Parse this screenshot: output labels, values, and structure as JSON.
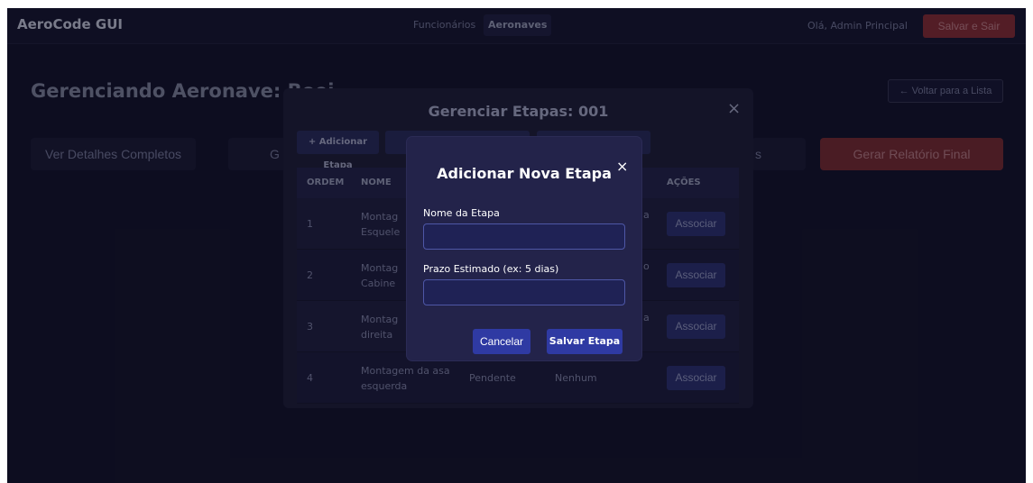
{
  "header": {
    "logo": "AeroCode GUI",
    "nav": [
      "Funcionários",
      "Aeronaves"
    ],
    "active_nav": "Aeronaves",
    "greeting": "Olá, Admin Principal",
    "save_exit_label": "Salvar e Sair"
  },
  "page": {
    "title_visible": "Gerenciando Aeronave: Boei",
    "back_label": "← Voltar para a Lista",
    "actions": [
      "Ver Detalhes Completos",
      "G",
      "s",
      "Gerar Relatório Final"
    ]
  },
  "etapas_modal": {
    "title": "Gerenciar Etapas: 001",
    "close_glyph": "×",
    "add_etapa_label": "+ Adicionar Etapa",
    "table": {
      "headers": {
        "ordem": "ORDEM",
        "nome": "NOME",
        "acoes": "AÇÕES"
      },
      "rows": [
        {
          "ordem": "1",
          "nome_line1": "Montag",
          "nome_line2": "Esquele",
          "status": "",
          "func": "a"
        },
        {
          "ordem": "2",
          "nome_line1": "Montag",
          "nome_line2": "Cabine",
          "status": "",
          "func": "o"
        },
        {
          "ordem": "3",
          "nome_line1": "Montag",
          "nome_line2": "direita",
          "status": "",
          "func": "a"
        },
        {
          "ordem": "4",
          "nome_line1": "Montagem da asa",
          "nome_line2": "esquerda",
          "status": "Pendente",
          "func": "Nenhum"
        }
      ],
      "assoc_label": "Associar"
    }
  },
  "add_modal": {
    "title": "Adicionar Nova Etapa",
    "close_glyph": "×",
    "name_label": "Nome da Etapa",
    "name_value": "",
    "prazo_label": "Prazo Estimado (ex: 5 dias)",
    "prazo_value": "",
    "cancel_label": "Cancelar",
    "save_label": "Salvar Etapa"
  },
  "colors": {
    "background": "#13132a",
    "accent_blue": "#2f3aa3",
    "danger_red": "#7f2c33",
    "modal_bg": "#23234a"
  }
}
